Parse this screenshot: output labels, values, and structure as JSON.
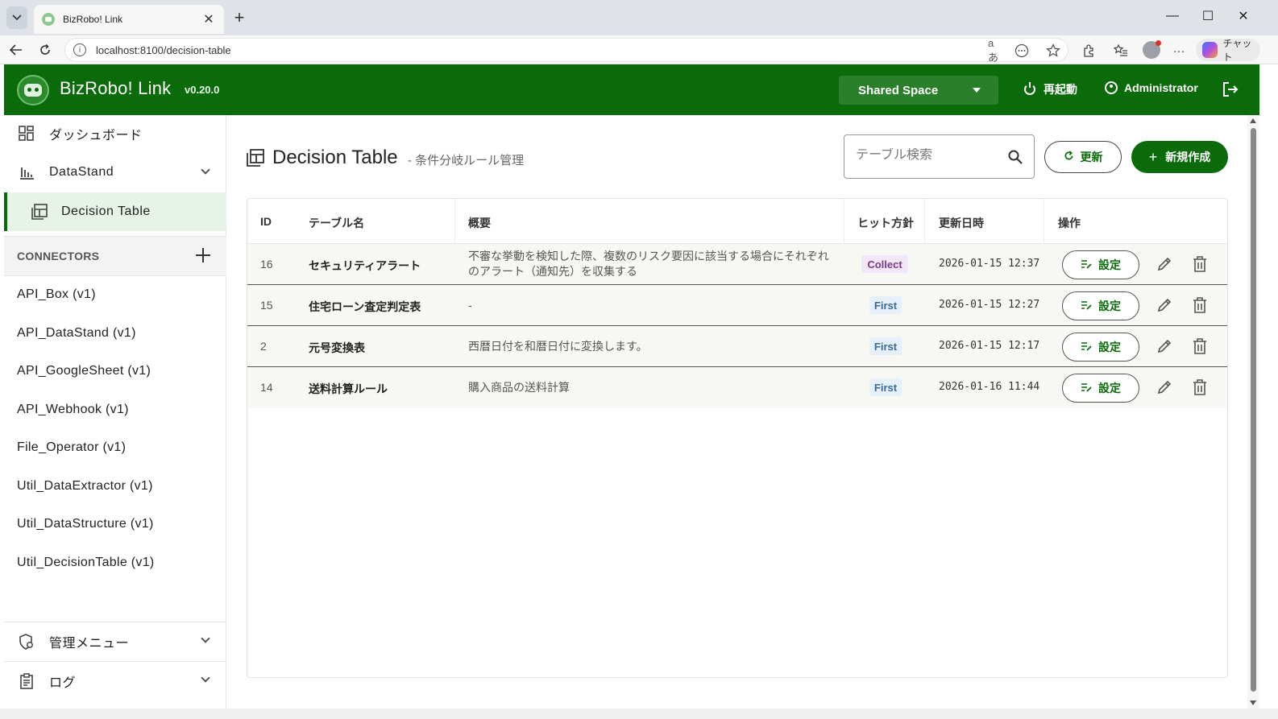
{
  "browser": {
    "tab_title": "BizRobo! Link",
    "tab_close": "✕",
    "new_tab": "+",
    "url": "localhost:8100/decision-table",
    "read_aloud": "aあ",
    "copilot_label": "チャット",
    "window_minimize": "—",
    "window_maximize": "☐",
    "window_close": "✕"
  },
  "header": {
    "brand": "BizRobo! Link",
    "version": "v0.20.0",
    "space": "Shared Space",
    "restart_label": "再起動",
    "user_label": "Administrator"
  },
  "sidebar": {
    "dashboard": "ダッシュボード",
    "datastand": "DataStand",
    "decision_table": "Decision Table",
    "connectors_header": "CONNECTORS",
    "connectors": [
      "API_Box (v1)",
      "API_DataStand (v1)",
      "API_GoogleSheet (v1)",
      "API_Webhook (v1)",
      "File_Operator (v1)",
      "Util_DataExtractor (v1)",
      "Util_DataStructure (v1)",
      "Util_DecisionTable (v1)"
    ],
    "admin_menu": "管理メニュー",
    "logs": "ログ"
  },
  "main": {
    "title": "Decision Table",
    "subtitle": "- 条件分岐ルール管理",
    "search_placeholder": "テーブル検索",
    "refresh_label": "更新",
    "create_label": "新規作成",
    "table": {
      "headers": {
        "id": "ID",
        "name": "テーブル名",
        "desc": "概要",
        "hit": "ヒット方針",
        "updated": "更新日時",
        "actions": "操作"
      },
      "rows": [
        {
          "id": "16",
          "name": "セキュリティアラート",
          "desc1": "不審な挙動を検知した際、複数のリスク要因に該当する場合にそれぞれ",
          "desc2": "のアラート（通知先）を収集する",
          "hit": "Collect",
          "updated": "2026-01-15 12:37",
          "action": "設定"
        },
        {
          "id": "15",
          "name": "住宅ローン査定判定表",
          "desc1": "-",
          "desc2": "",
          "hit": "First",
          "updated": "2026-01-15 12:27",
          "action": "設定"
        },
        {
          "id": "2",
          "name": "元号変換表",
          "desc1": "西暦日付を和暦日付に変換します。",
          "desc2": "",
          "hit": "First",
          "updated": "2026-01-15 12:17",
          "action": "設定"
        },
        {
          "id": "14",
          "name": "送料計算ルール",
          "desc1": "購入商品の送料計算",
          "desc2": "",
          "hit": "First",
          "updated": "2026-01-16 11:44",
          "action": "設定"
        }
      ]
    }
  },
  "colors": {
    "brand_green": "#0b6b0b",
    "active_bg": "#e8f3e8",
    "collect_badge": "#f3e6f6",
    "first_badge": "#e5f0fa"
  }
}
